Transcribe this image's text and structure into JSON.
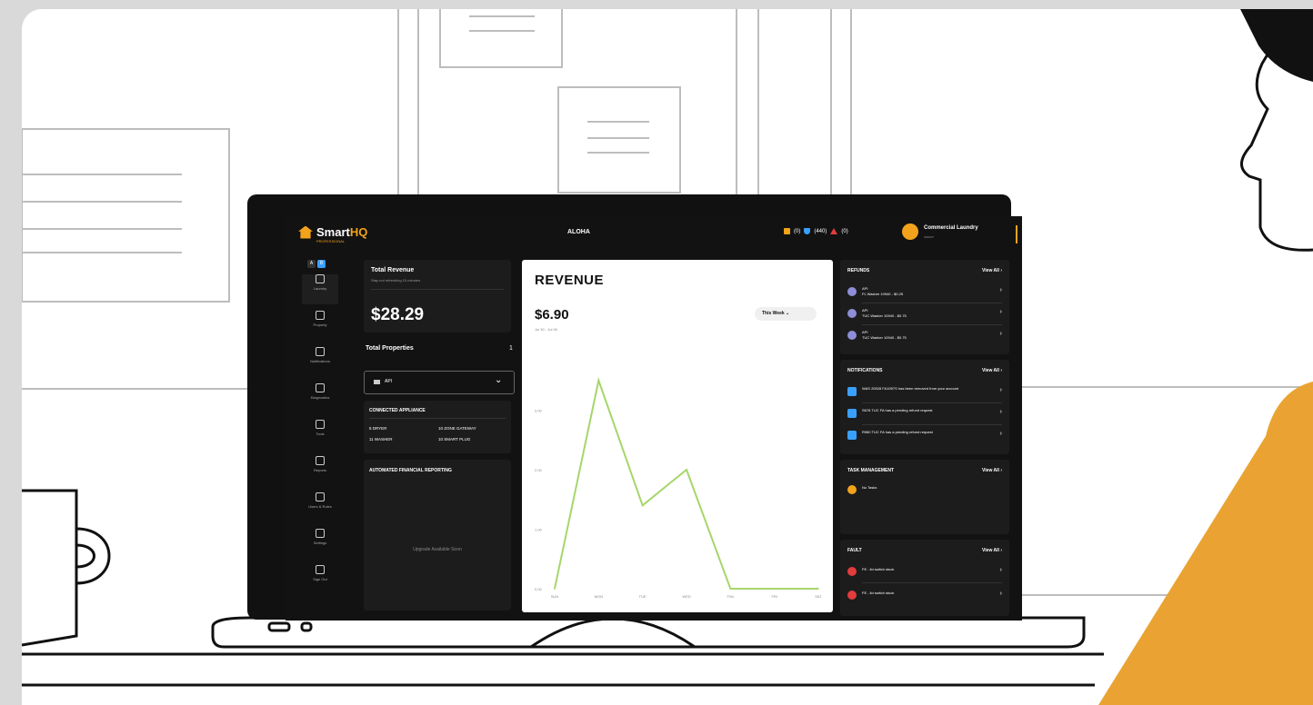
{
  "header": {
    "brand_smart": "Smart",
    "brand_hq": "HQ",
    "brand_sub": "PROFESSIONAL",
    "location": "ALOHA",
    "status_yellow": "(0)",
    "status_blue": "(440)",
    "status_red": "(0)",
    "user_name": "Commercial Laundry",
    "user_role": "owner"
  },
  "sidebar": {
    "toggle_left": "A",
    "toggle_right": "B",
    "items": [
      "Laundry",
      "Property",
      "Notifications",
      "Diagnostics",
      "Tools",
      "Reports",
      "Users & Roles",
      "Settings",
      "Sign Out"
    ]
  },
  "total_revenue": {
    "title": "Total Revenue",
    "subtitle": "Stay not refreshing 15 minutes",
    "value": "$28.29"
  },
  "total_properties": {
    "label": "Total Properties",
    "count": "1",
    "selected": "API"
  },
  "connected": {
    "title": "CONNECTED APPLIANCE",
    "items": [
      "8 DRYER",
      "10 ZONE GATEWAY",
      "11 WASHER",
      "10 SMART PLUG"
    ]
  },
  "financial": {
    "title": "AUTOMATED FINANCIAL REPORTING",
    "note": "Upgrade Available Soon"
  },
  "revenue_panel": {
    "title": "REVENUE",
    "amount": "$6.90",
    "range": "Jul 30 - Jul 06",
    "period": "This Week"
  },
  "chart_data": {
    "type": "line",
    "categories": [
      "SUN",
      "MON",
      "TUE",
      "WED",
      "THU",
      "FRI",
      "SAT"
    ],
    "values": [
      0.0,
      3.5,
      1.4,
      2.0,
      0.0,
      0.0,
      0.0
    ],
    "ytick_labels": [
      "0.00",
      "1.00",
      "2.00",
      "3.00"
    ],
    "ylim": [
      0,
      4
    ],
    "color": "#a6d66a"
  },
  "refunds": {
    "title": "REFUNDS",
    "view_all": "View All",
    "items": [
      {
        "line1": "API",
        "line2": "FL Washer 10940 - $0.25"
      },
      {
        "line1": "API",
        "line2": "TUC Washer 10940 - $0.75"
      },
      {
        "line1": "API",
        "line2": "TUC Washer 10940 - $0.75"
      }
    ]
  },
  "notifications": {
    "title": "NOTIFICATIONS",
    "view_all": "View All",
    "items": [
      "WAS 20528 FA1957S has been removed from your account",
      "S678 TUC FA has a pending refund request",
      "R980 TUC FA has a pending refund request"
    ]
  },
  "task_management": {
    "title": "TASK MANAGEMENT",
    "view_all": "View All",
    "item": "No Tasks"
  },
  "fault": {
    "title": "FAULT",
    "view_all": "View All",
    "items": [
      "FE - lid switch stuck",
      "FE - lid switch stuck"
    ]
  },
  "colors": {
    "accent": "#f2a31b",
    "blue": "#3aa0ff",
    "red": "#e23c3c",
    "line": "#a6d66a"
  }
}
